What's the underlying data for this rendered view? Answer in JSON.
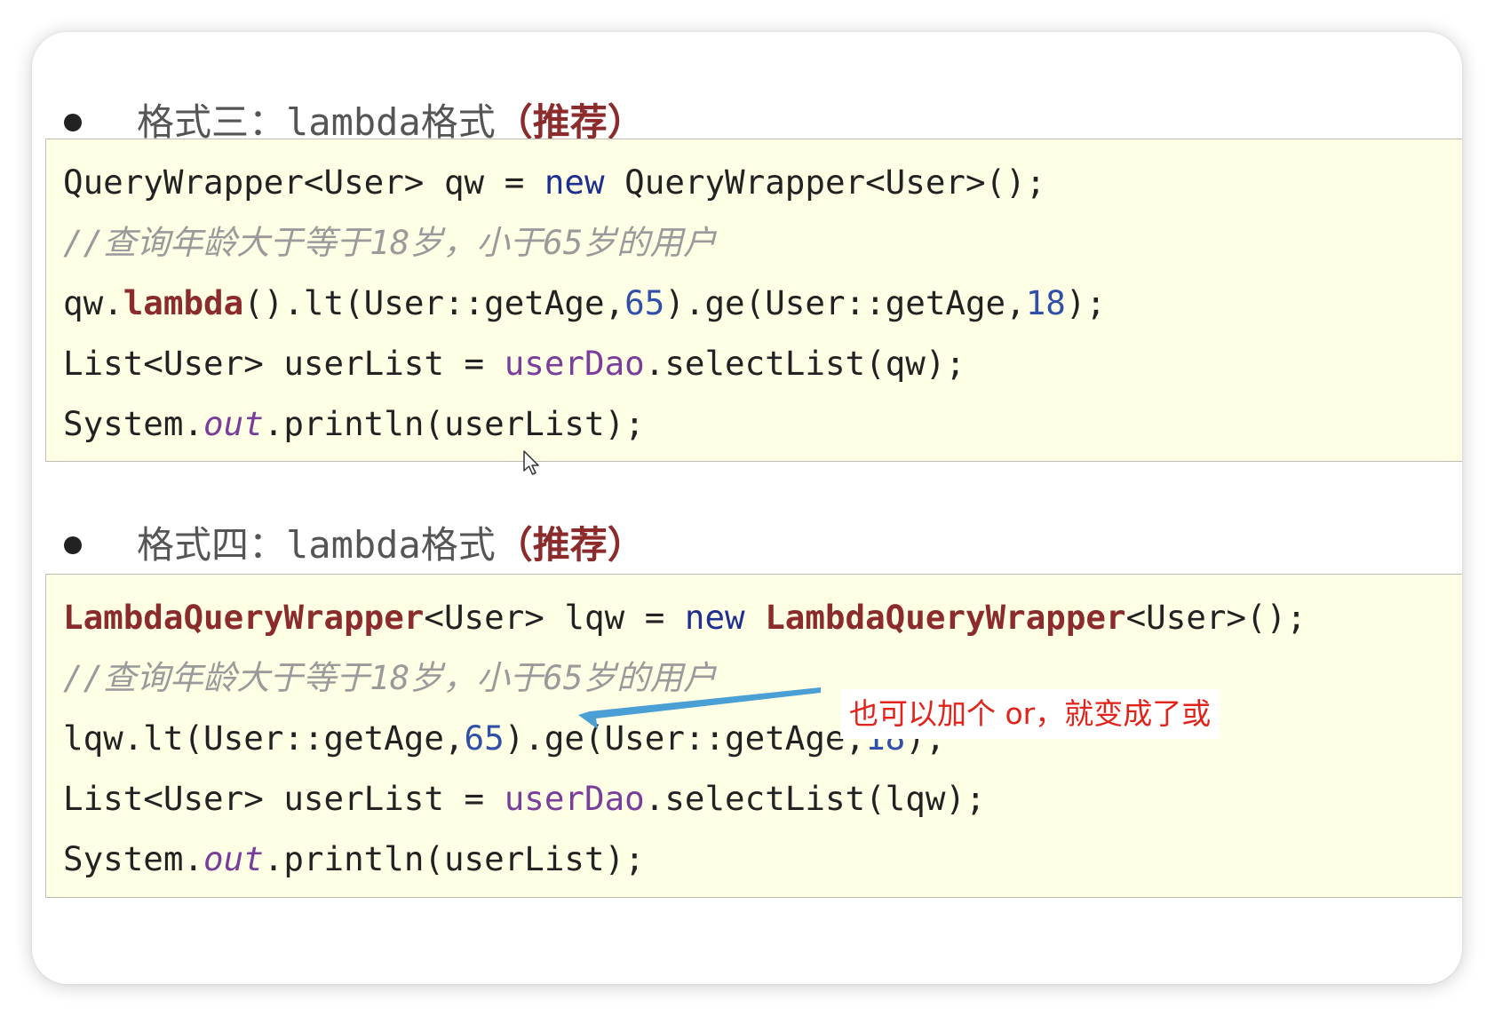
{
  "section3": {
    "heading_prefix": "格式三：",
    "heading_mono": "lambda",
    "heading_suffix": "格式",
    "heading_recommend": "（推荐）",
    "code": {
      "l1_a": "QueryWrapper<User> qw = ",
      "l1_kw": "new",
      "l1_b": " QueryWrapper<User>();",
      "l2_comment": "//查询年龄大于等于18岁，小于65岁的用户",
      "l3_a": "qw.",
      "l3_method": "lambda",
      "l3_b": "().lt(User::getAge,",
      "l3_n1": "65",
      "l3_c": ").ge(User::getAge,",
      "l3_n2": "18",
      "l3_d": ");",
      "l4_a": "List<User> userList = ",
      "l4_field": "userDao",
      "l4_b": ".selectList(qw);",
      "l5_a": "System.",
      "l5_italic": "out",
      "l5_b": ".println(userList);"
    }
  },
  "section4": {
    "heading_prefix": "格式四：",
    "heading_mono": "lambda",
    "heading_suffix": "格式",
    "heading_recommend": "（推荐）",
    "code": {
      "l1_cls": "LambdaQueryWrapper",
      "l1_a": "<User> lqw = ",
      "l1_kw": "new",
      "l1_space": " ",
      "l1_cls2": "LambdaQueryWrapper",
      "l1_b": "<User>();",
      "l2_comment": "//查询年龄大于等于18岁，小于65岁的用户",
      "l3_a": "lqw.lt(User::getAge,",
      "l3_n1": "65",
      "l3_b": ").ge(User::getAge,",
      "l3_n2": "18",
      "l3_c": ");",
      "l4_a": "List<User> userList = ",
      "l4_field": "userDao",
      "l4_b": ".selectList(lqw);",
      "l5_a": "System.",
      "l5_italic": "out",
      "l5_b": ".println(userList);"
    }
  },
  "annotation": {
    "text": "也可以加个 or，就变成了或",
    "color": "#e0241b",
    "arrow_color": "#4a9fd4"
  },
  "colors": {
    "code_bg": "#ffffe6",
    "keyword": "#1f2f8f",
    "number": "#2f4fa8",
    "field": "#7a3d9a",
    "emphasis": "#8b2b2b",
    "comment": "#9a9a9a"
  }
}
